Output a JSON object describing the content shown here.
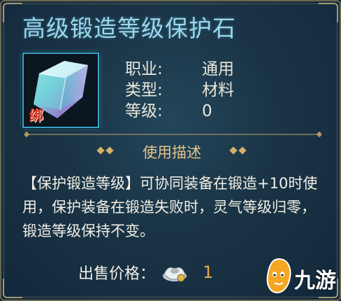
{
  "item": {
    "name": "高级锻造等级保护石",
    "bind_badge": "绑",
    "attributes": [
      {
        "label": "职业:",
        "value": "通用"
      },
      {
        "label": "类型:",
        "value": "材料"
      },
      {
        "label": "等级:",
        "value": "0"
      }
    ]
  },
  "usage": {
    "section_title": "使用描述",
    "description": "【保护锻造等级】可协同装备在锻造+10时使用，保护装备在锻造失败时，灵气等级归零，锻造等级保持不变。"
  },
  "price": {
    "label": "出售价格：",
    "currency_icon": "silver-ingot-icon",
    "value": "1"
  },
  "watermark": {
    "text": "九游"
  },
  "colors": {
    "title": "#9ed7ea",
    "section_title": "#e4c48a",
    "price_value": "#e6a94b",
    "icon_border": "#3aa7c9",
    "bind_badge": "#e23a2a"
  }
}
